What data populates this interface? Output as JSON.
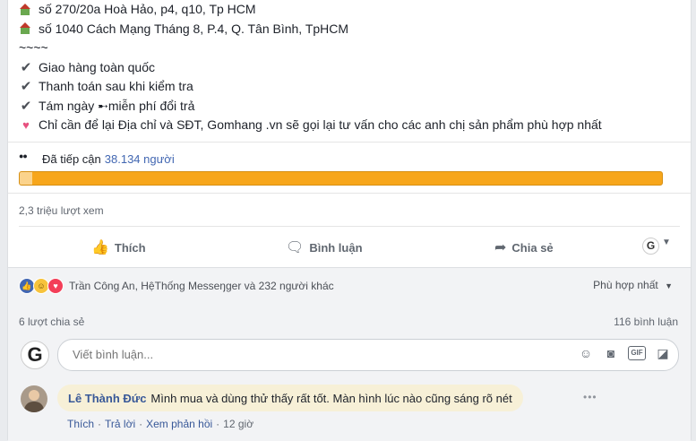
{
  "post": {
    "lines": [
      {
        "icon": "house-icon",
        "text": "số 270/20a Hoà Hảo, p4, q10, Tp HCM"
      },
      {
        "icon": "house-icon",
        "text": "số 1040 Cách Mạng Tháng 8, P.4, Q. Tân Bình, TpHCM"
      },
      {
        "icon": "",
        "text": "~~~~"
      },
      {
        "icon": "check-icon",
        "text": "Giao hàng toàn quốc"
      },
      {
        "icon": "check-icon",
        "text": "Thanh toán sau khi kiểm tra"
      },
      {
        "icon": "check-icon",
        "text": "Tám ngày ➸miễn phí đổi trả"
      },
      {
        "icon": "heart-icon",
        "text": "Chỉ cần để lại Địa chỉ và SĐT, Gomhang .vn sẽ gọi lại tư vấn cho các anh chị sản phẩm phù hợp nhất"
      }
    ]
  },
  "reach": {
    "label": "Đã tiếp cận",
    "count": "38.134 người",
    "bar_fill_fraction": 0.02,
    "bar_color": "#f7a61b"
  },
  "views": "2,3 triệu lượt xem",
  "actions": {
    "like": "Thích",
    "comment": "Bình luận",
    "share": "Chia sẻ",
    "avatar_letter": "G"
  },
  "reactions": {
    "names": "Trần Công An, HệThống Messeŋger và 232 người khác",
    "sort": "Phù hợp nhất"
  },
  "stats": {
    "shares": "6 lượt chia sẻ",
    "comments": "116 bình luận"
  },
  "composer": {
    "avatar_letter": "G",
    "placeholder": "Viết bình luận..."
  },
  "comment": {
    "author": "Lê Thành Đức",
    "text": "Mình mua và dùng thử thấy rất tốt. Màn hình lúc nào cũng sáng rõ nét",
    "like": "Thích",
    "reply": "Trả lời",
    "see_replies": "Xem phản hồi",
    "time": "12 giờ",
    "dot": "·"
  },
  "colors": {
    "link": "#385898",
    "accent": "#4267b2",
    "comment_bg": "#f7f0d7"
  }
}
